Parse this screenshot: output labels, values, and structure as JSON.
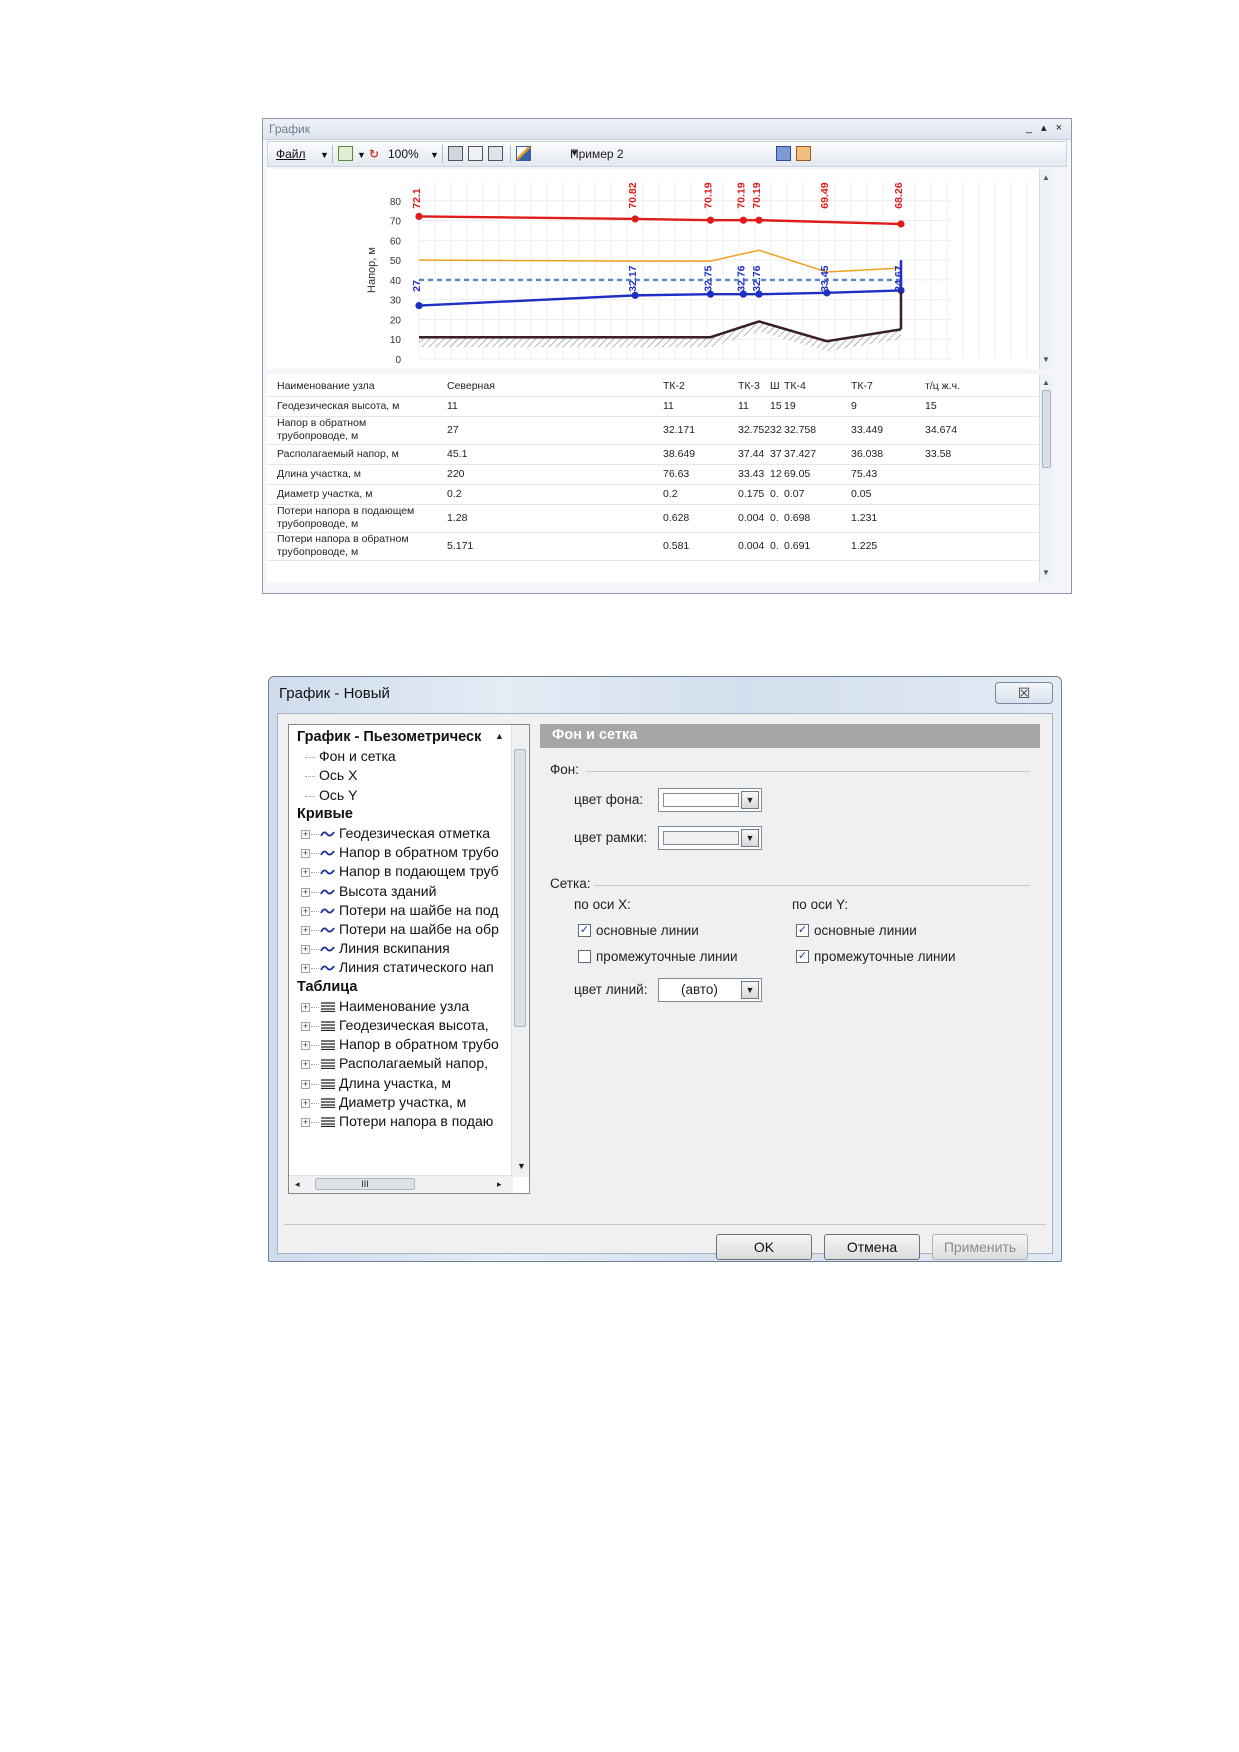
{
  "graph_window": {
    "title": "График",
    "window_buttons": "_ ▴ ×",
    "toolbar": {
      "file_label": "Файл",
      "zoom_label": "100%",
      "example_label": "Пример 2"
    }
  },
  "chart_data": {
    "type": "line",
    "ylabel": "Напор, м",
    "ylim": [
      0,
      90
    ],
    "yticks": [
      0,
      10,
      20,
      30,
      40,
      50,
      60,
      70,
      80
    ],
    "grid": true,
    "x_positions": [
      0,
      220,
      296.63,
      330.06,
      346,
      415.05,
      490.48
    ],
    "node_names": [
      "Северная",
      "ТК-2",
      "ТК-3",
      "Ш",
      "ТК-4",
      "ТК-7",
      "т/ц ж.ч."
    ],
    "series": [
      {
        "role": "supply",
        "color": "#e01b1b",
        "x": [
          0,
          220,
          296.63,
          330.06,
          346,
          490.48
        ],
        "y": [
          72.1,
          70.82,
          70.19,
          70.19,
          70.19,
          68.26
        ]
      },
      {
        "role": "return",
        "color": "#1d2fc4",
        "x": [
          0,
          220,
          296.63,
          330.06,
          346,
          415.05,
          490.48
        ],
        "y": [
          27,
          32.17,
          32.75,
          32.76,
          32.76,
          33.45,
          34.67
        ]
      },
      {
        "role": "building",
        "color": "#f0a020",
        "x": [
          0,
          220,
          296.63,
          346,
          415.05,
          490.48
        ],
        "y": [
          50,
          49.5,
          49.5,
          55,
          44,
          46
        ]
      },
      {
        "role": "static",
        "color": "#5b86c5",
        "dashed": true,
        "x": [
          0,
          490.48
        ],
        "y": [
          40,
          40
        ]
      },
      {
        "role": "terrain",
        "color": "#3a2020",
        "x": [
          0,
          220,
          296.63,
          346,
          415.05,
          490.48
        ],
        "y": [
          11,
          11,
          11,
          19,
          9,
          15
        ]
      }
    ],
    "labels_supply": [
      {
        "x": 0,
        "text": "72.1"
      },
      {
        "x": 220,
        "text": "70.82"
      },
      {
        "x": 296.63,
        "text": "70.19"
      },
      {
        "x": 330.06,
        "text": "70.19"
      },
      {
        "x": 346,
        "text": "70.19"
      },
      {
        "x": 415.05,
        "text": "69.49"
      },
      {
        "x": 490.48,
        "text": "68.26"
      }
    ],
    "labels_return": [
      {
        "x": 0,
        "text": "27"
      },
      {
        "x": 220,
        "text": "32.17"
      },
      {
        "x": 296.63,
        "text": "32.75"
      },
      {
        "x": 330.06,
        "text": "32.76"
      },
      {
        "x": 346,
        "text": "32.76"
      },
      {
        "x": 415.05,
        "text": "33.45"
      },
      {
        "x": 490.48,
        "text": "34.67"
      }
    ]
  },
  "data_table": {
    "rows": [
      {
        "label": [
          "Наименование узла"
        ],
        "cells": [
          "Северная",
          "ТК-2",
          "ТК-3",
          "Ш",
          "ТК-4",
          "ТК-7",
          "т/ц ж.ч."
        ]
      },
      {
        "label": [
          "Геодезическая высота, м"
        ],
        "cells": [
          "11",
          "11",
          "11",
          "15",
          "19",
          "9",
          "15"
        ]
      },
      {
        "label": [
          "Напор в обратном",
          "трубопроводе, м"
        ],
        "cells": [
          "27",
          "32.171",
          "32.752",
          "32",
          "32.758",
          "33.449",
          "34.674"
        ]
      },
      {
        "label": [
          "Располагаемый напор, м"
        ],
        "cells": [
          "45.1",
          "38.649",
          "37.44",
          "37",
          "37.427",
          "36.038",
          "33.58"
        ]
      },
      {
        "label": [
          "Длина участка, м"
        ],
        "cells": [
          "220",
          "76.63",
          "33.43",
          "12",
          "69.05",
          "75.43",
          ""
        ]
      },
      {
        "label": [
          "Диаметр участка, м"
        ],
        "cells": [
          "0.2",
          "0.2",
          "0.175",
          "0.",
          "0.07",
          "0.05",
          ""
        ]
      },
      {
        "label": [
          "Потери напора в подающем",
          "трубопроводе, м"
        ],
        "cells": [
          "1.28",
          "0.628",
          "0.004",
          "0.",
          "0.698",
          "1.231",
          ""
        ]
      },
      {
        "label": [
          "Потери напора в обратном",
          "трубопроводе, м"
        ],
        "cells": [
          "5.171",
          "0.581",
          "0.004",
          "0.",
          "0.691",
          "1.225",
          ""
        ]
      }
    ]
  },
  "settings_dialog": {
    "title": "График - Новый",
    "close_glyph": "☒",
    "tree": {
      "root": "График - Пьезометрическ",
      "root_children": [
        "Фон и сетка",
        "Ось X",
        "Ось Y"
      ],
      "curves_header": "Кривые",
      "curves": [
        "Геодезическая отметка",
        "Напор в обратном трубо",
        "Напор в подающем труб",
        "Высота зданий",
        "Потери на шайбе на под",
        "Потери на шайбе на обр",
        "Линия вскипания",
        "Линия статического нап"
      ],
      "table_header": "Таблица",
      "table_items": [
        "Наименование узла",
        "Геодезическая высота,",
        "Напор в обратном трубо",
        "Располагаемый напор,",
        "Длина участка, м",
        "Диаметр участка, м",
        "Потери напора в подаю"
      ],
      "hscroll_thumb": "III"
    },
    "panel": {
      "header": "Фон и сетка",
      "background_group": "Фон:",
      "bg_color_label": "цвет фона:",
      "frame_color_label": "цвет рамки:",
      "grid_group": "Сетка:",
      "x_axis_label": "по оси X:",
      "y_axis_label": "по оси Y:",
      "main_lines": "основные линии",
      "minor_lines": "промежуточные линии",
      "x_main_checked": true,
      "x_minor_checked": false,
      "y_main_checked": true,
      "y_minor_checked": true,
      "line_color_label": "цвет линий:",
      "line_color_value": "(авто)"
    },
    "buttons": {
      "ok": "OK",
      "cancel": "Отмена",
      "apply": "Применить"
    }
  }
}
